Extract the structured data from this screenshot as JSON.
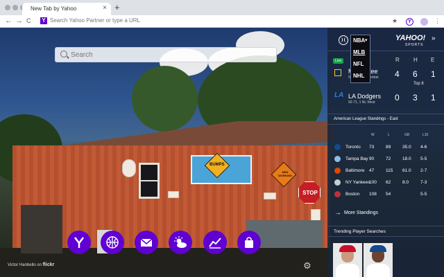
{
  "browser": {
    "tab_title": "New Tab by Yahoo",
    "tab_close": "×",
    "new_tab": "+",
    "favicon": "Y",
    "omnibox_placeholder": "Search Yahoo Partner or type a URL",
    "nav": {
      "back": "←",
      "forward": "→",
      "reload": "C"
    },
    "toolbar_icons": [
      "star-icon",
      "yahoo-extension-icon",
      "profile-icon",
      "menu-icon"
    ],
    "star": "★",
    "ext_letter": "Y",
    "menu": "⋮"
  },
  "search": {
    "placeholder": "Search"
  },
  "dock": {
    "items": [
      "yahoo-home-icon",
      "sports-ball-icon",
      "mail-icon",
      "weather-icon",
      "finance-chart-icon",
      "shopping-bag-icon"
    ],
    "accent": "#5f01d1"
  },
  "photo_credit": {
    "author": "Victor Hanbello on",
    "site": "flickr"
  },
  "photo_signs": {
    "bumps": "BUMPS",
    "men_working": "MEN WORKING",
    "stop": "STOP"
  },
  "sidebar": {
    "logo": "YAHOO!",
    "logo_sub": "SPORTS",
    "collapse": "»",
    "league_menu": [
      "NBA",
      "MLB",
      "NFL",
      "NHL"
    ],
    "league_selected": "MLB",
    "game": {
      "status": "Live",
      "headers": [
        "R",
        "H",
        "E"
      ],
      "teams": [
        {
          "name": "Milwaukee",
          "record": "96-67, 1 NL Central",
          "runs": "4",
          "hits": "6",
          "errors": "1"
        },
        {
          "name": "LA Dodgers",
          "record": "92-71, 1 NL West",
          "runs": "0",
          "hits": "3",
          "errors": "1"
        }
      ],
      "inning": "Top 8"
    },
    "standings": {
      "title": "American League Standings - East",
      "columns": [
        "W",
        "L",
        "GB",
        "L10"
      ],
      "rows": [
        {
          "team": "Toronto",
          "w": "73",
          "l": "89",
          "gb": "35.0",
          "l10": "4-6",
          "color": "#134a8e"
        },
        {
          "team": "Tampa Bay",
          "w": "90",
          "l": "72",
          "gb": "18.0",
          "l10": "5-5",
          "color": "#8fbce6"
        },
        {
          "team": "Baltimore",
          "w": "47",
          "l": "115",
          "gb": "61.0",
          "l10": "2-7",
          "color": "#df4601"
        },
        {
          "team": "NY Yankees",
          "w": "100",
          "l": "62",
          "gb": "8.0",
          "l10": "7-3",
          "color": "#c4ced3"
        },
        {
          "team": "Boston",
          "w": "108",
          "l": "54",
          "gb": "",
          "l10": "5-5",
          "color": "#bd3039"
        }
      ],
      "more_label": "More Standings",
      "more_arrow": "→"
    },
    "trending": {
      "title": "Trending Player Searches"
    }
  },
  "settings_icon": "⚙"
}
